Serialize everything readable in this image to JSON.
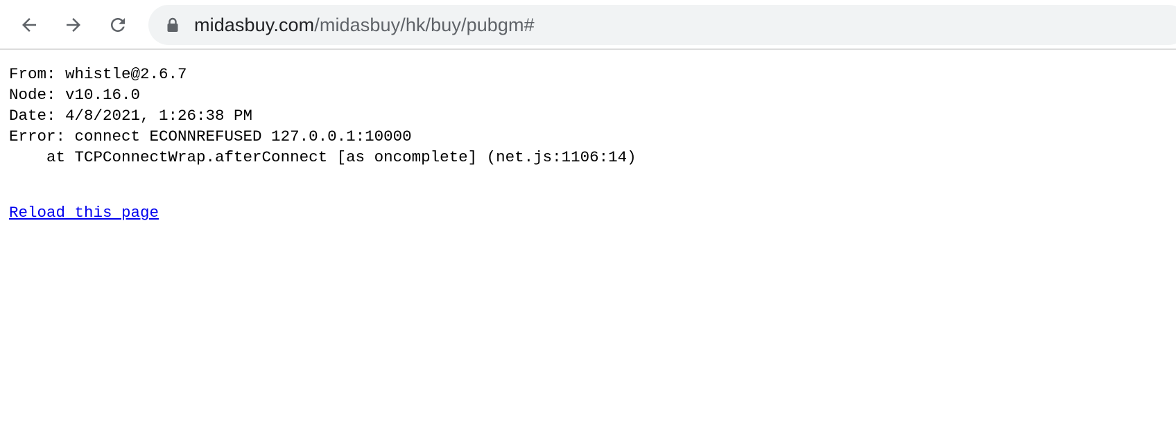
{
  "browser": {
    "url_host": "midasbuy.com",
    "url_path": "/midasbuy/hk/buy/pubgm#",
    "icons": {
      "back": "back-arrow-icon",
      "forward": "forward-arrow-icon",
      "reload": "reload-icon",
      "lock": "lock-icon"
    },
    "icon_color": "#5f6368",
    "omnibox_bg": "#f1f3f4"
  },
  "page": {
    "lines": [
      "From: whistle@2.6.7",
      "Node: v10.16.0",
      "Date: 4/8/2021, 1:26:38 PM",
      "Error: connect ECONNREFUSED 127.0.0.1:10000",
      "    at TCPConnectWrap.afterConnect [as oncomplete] (net.js:1106:14)"
    ],
    "reload_link": "Reload this page",
    "link_color": "#0000ee"
  }
}
